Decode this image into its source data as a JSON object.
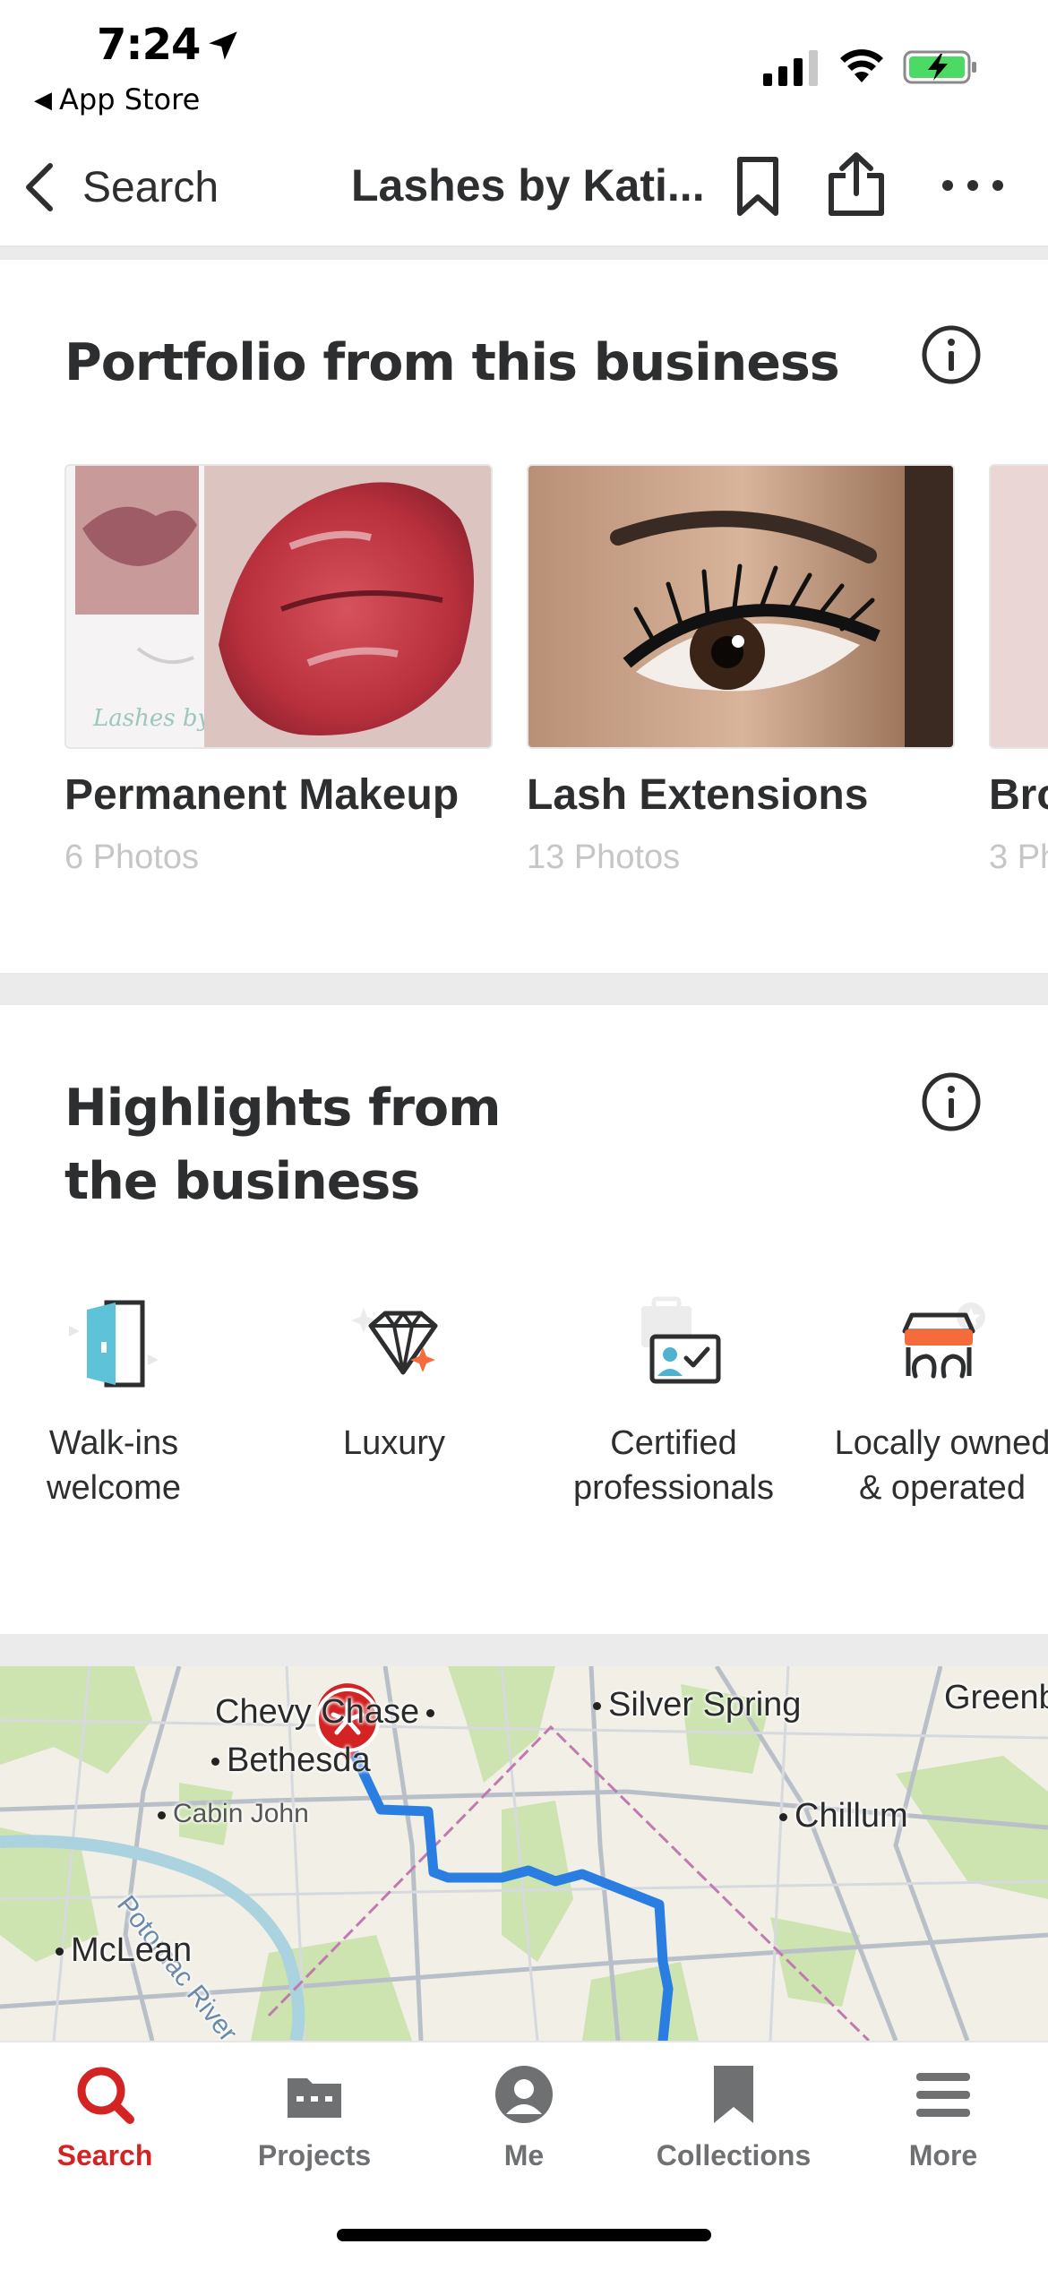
{
  "status_bar": {
    "time": "7:24",
    "back_app_label": "App Store"
  },
  "nav": {
    "back_label": "Search",
    "title": "Lashes by Kati..."
  },
  "portfolio": {
    "title": "Portfolio from this business",
    "cards": [
      {
        "label": "Permanent Makeup",
        "sub": "6 Photos"
      },
      {
        "label": "Lash Extensions",
        "sub": "13 Photos"
      },
      {
        "label": "Bro",
        "sub": "3 Ph"
      }
    ],
    "watermark": "Lashes by Katie"
  },
  "highlights": {
    "title_line1": "Highlights from",
    "title_line2": "the business",
    "items": [
      {
        "label": "Walk-ins\nwelcome",
        "icon": "door-icon"
      },
      {
        "label": "Luxury",
        "icon": "diamond-icon"
      },
      {
        "label": "Certified\nprofessionals",
        "icon": "certificate-icon"
      },
      {
        "label": "Locally owned\n& operated",
        "icon": "storefront-icon"
      }
    ]
  },
  "map": {
    "labels": {
      "chevy_chase": "Chevy Chase",
      "silver_spring": "Silver Spring",
      "greenbelt": "Greenb",
      "bethesda": "Bethesda",
      "cabin_john": "Cabin John",
      "chillum": "Chillum",
      "potomac": "Potomac River",
      "mclean": "McLean"
    }
  },
  "tabs": [
    {
      "label": "Search",
      "icon": "search-icon",
      "active": true
    },
    {
      "label": "Projects",
      "icon": "projects-icon",
      "active": false
    },
    {
      "label": "Me",
      "icon": "profile-icon",
      "active": false
    },
    {
      "label": "Collections",
      "icon": "bookmark-icon",
      "active": false
    },
    {
      "label": "More",
      "icon": "menu-icon",
      "active": false
    }
  ],
  "colors": {
    "brand_red": "#d32323",
    "route_blue": "#2a7de1",
    "text_dark": "#2d2e2f",
    "muted": "#c6c6c6"
  }
}
